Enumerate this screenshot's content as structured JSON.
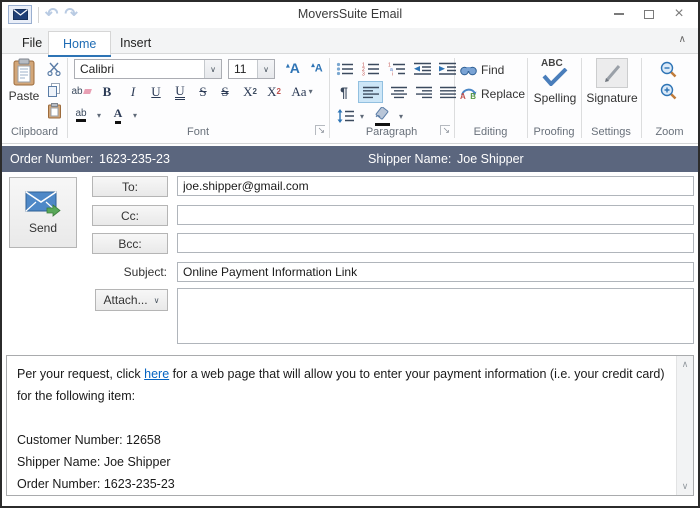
{
  "window": {
    "title": "MoversSuite Email"
  },
  "titlebar": {
    "close_glyph": "×"
  },
  "tabs": {
    "file": "File",
    "home": "Home",
    "insert": "Insert"
  },
  "icons": {
    "chevron_up": "∧",
    "chevron_down": "∨",
    "dropdown": "▾",
    "launcher": "↘",
    "pilcrow": "¶",
    "undo": "↶",
    "redo": "↷"
  },
  "ribbon": {
    "clipboard": {
      "group_label": "Clipboard",
      "paste_label": "Paste"
    },
    "font": {
      "group_label": "Font",
      "font_name": "Calibri",
      "font_size": "11",
      "grow_font": "A",
      "shrink_font": "A",
      "clear_format": "ab",
      "bold": "B",
      "italic": "I",
      "underline": "U",
      "double_underline": "U",
      "strikethrough": "S",
      "double_strikethrough": "S",
      "superscript_base": "X",
      "superscript_exp": "2",
      "subscript_base": "X",
      "subscript_sub": "2",
      "change_case": "Aa",
      "highlight": "ab",
      "font_color": "A"
    },
    "paragraph": {
      "group_label": "Paragraph"
    },
    "editing": {
      "group_label": "Editing",
      "find": "Find",
      "replace": "Replace",
      "replace_a": "A",
      "replace_b": "B"
    },
    "proofing": {
      "group_label": "Proofing",
      "spelling": "Spelling",
      "abc": "ABC"
    },
    "settings": {
      "group_label": "Settings",
      "signature": "Signature"
    },
    "zoom": {
      "group_label": "Zoom"
    }
  },
  "info_bar": {
    "order_label": "Order Number:",
    "order_value": "1623-235-23",
    "shipper_label": "Shipper Name:",
    "shipper_value": "Joe Shipper"
  },
  "compose": {
    "send": "Send",
    "to_label": "To:",
    "to_value": "joe.shipper@gmail.com",
    "cc_label": "Cc:",
    "cc_value": "",
    "bcc_label": "Bcc:",
    "bcc_value": "",
    "subject_label": "Subject:",
    "subject_value": "Online Payment Information Link",
    "attach_label": "Attach...",
    "attach_chevron": "∨"
  },
  "body": {
    "p1_before": "Per your request, click ",
    "link": "here",
    "p1_after": " for a web page that will allow you to enter your payment information (i.e. your credit card) for the following item:",
    "line_customer": "Customer Number: 12658",
    "line_shipper": "Shipper Name: Joe Shipper",
    "line_order": "Order Number: 1623-235-23"
  },
  "colors": {
    "info_bar_bg": "#5b667e",
    "active_tab_text": "#1f6cb4",
    "selected_button_bg": "#cde6f7",
    "link_color": "#0563c1",
    "ribbon_icon_blue": "#2e74b5"
  }
}
